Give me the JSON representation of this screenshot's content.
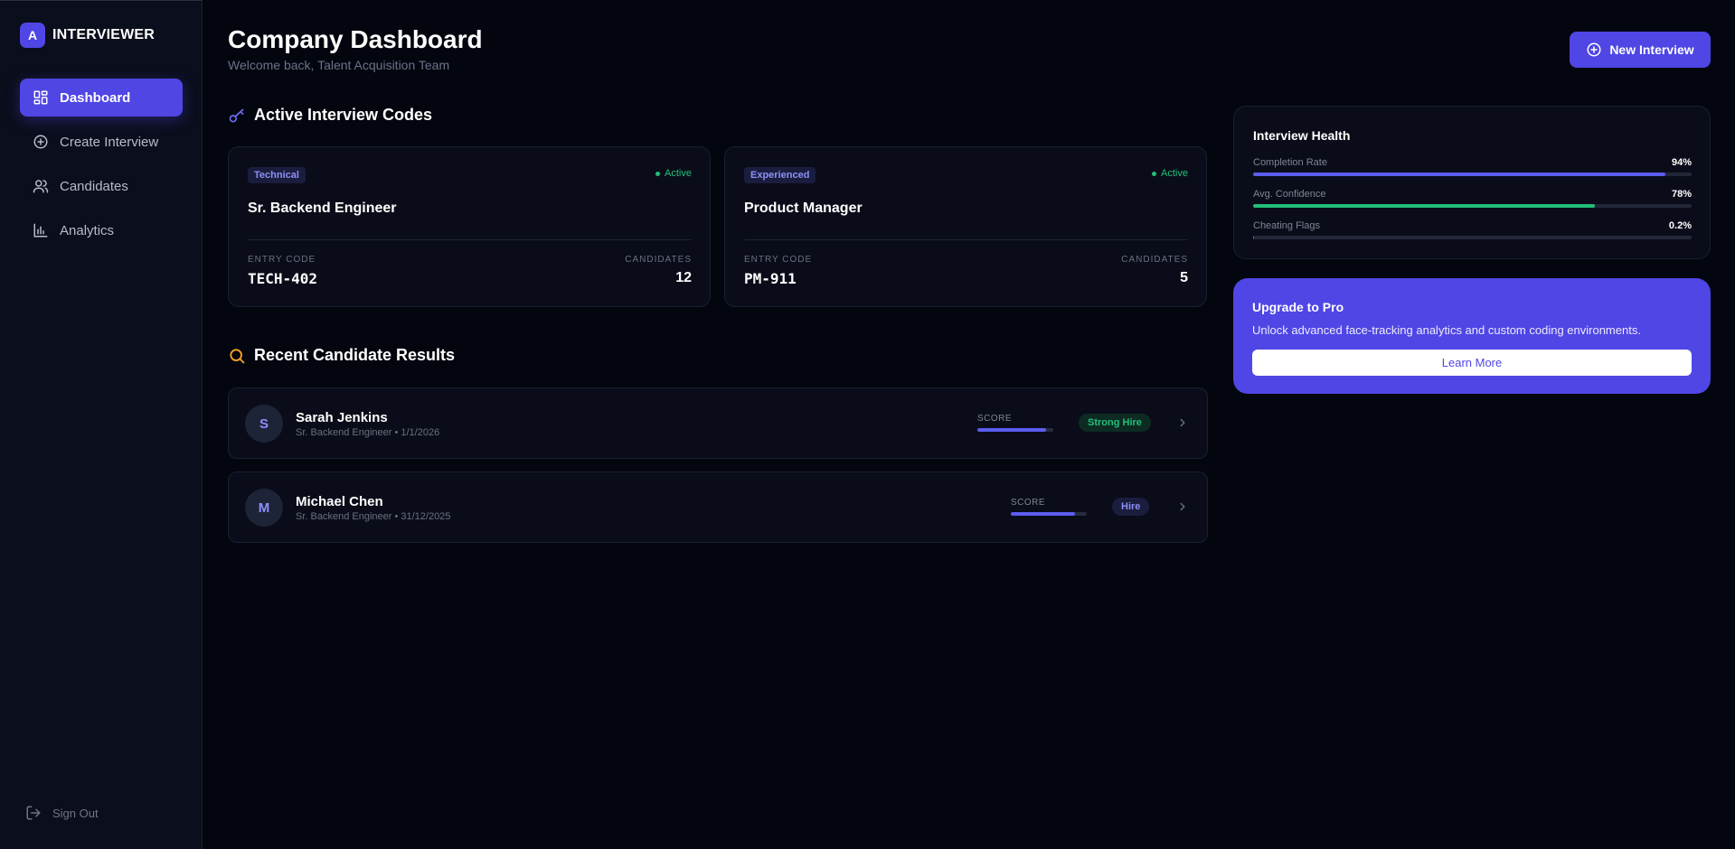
{
  "brand": {
    "logo_letter": "A",
    "name": "INTERVIEWER"
  },
  "sidebar": {
    "items": [
      {
        "label": "Dashboard",
        "icon": "dashboard-icon",
        "active": true
      },
      {
        "label": "Create Interview",
        "icon": "plus-circle-icon",
        "active": false
      },
      {
        "label": "Candidates",
        "icon": "users-icon",
        "active": false
      },
      {
        "label": "Analytics",
        "icon": "bar-chart-icon",
        "active": false
      }
    ],
    "signout_label": "Sign Out"
  },
  "header": {
    "title": "Company Dashboard",
    "subtitle": "Welcome back, Talent Acquisition Team",
    "new_button_label": "New Interview"
  },
  "codes_section": {
    "title": "Active Interview Codes",
    "entry_code_label": "ENTRY CODE",
    "candidates_label": "CANDIDATES",
    "cards": [
      {
        "tag": "Technical",
        "status": "Active",
        "role": "Sr. Backend Engineer",
        "code": "TECH-402",
        "candidates": "12"
      },
      {
        "tag": "Experienced",
        "status": "Active",
        "role": "Product Manager",
        "code": "PM-911",
        "candidates": "5"
      }
    ]
  },
  "results_section": {
    "title": "Recent Candidate Results",
    "score_label": "SCORE",
    "rows": [
      {
        "initial": "S",
        "name": "Sarah Jenkins",
        "meta": "Sr. Backend Engineer • 1/1/2026",
        "score_fraction": 0.9,
        "verdict": "Strong Hire",
        "verdict_kind": "strong"
      },
      {
        "initial": "M",
        "name": "Michael Chen",
        "meta": "Sr. Backend Engineer • 31/12/2025",
        "score_fraction": 0.85,
        "verdict": "Hire",
        "verdict_kind": "hire"
      }
    ]
  },
  "health": {
    "title": "Interview Health",
    "metrics": [
      {
        "label": "Completion Rate",
        "value": "94%",
        "fraction": 0.94,
        "color": "#5b5cf0"
      },
      {
        "label": "Avg. Confidence",
        "value": "78%",
        "fraction": 0.78,
        "color": "#22c07a"
      },
      {
        "label": "Cheating Flags",
        "value": "0.2%",
        "fraction": 0.002,
        "color": "#e5484d"
      }
    ]
  },
  "pro": {
    "title": "Upgrade to Pro",
    "text": "Unlock advanced face-tracking analytics and custom coding environments.",
    "button_label": "Learn More"
  },
  "colors": {
    "accent": "#4f46e5",
    "success": "#22c07a",
    "background": "#03050f"
  }
}
